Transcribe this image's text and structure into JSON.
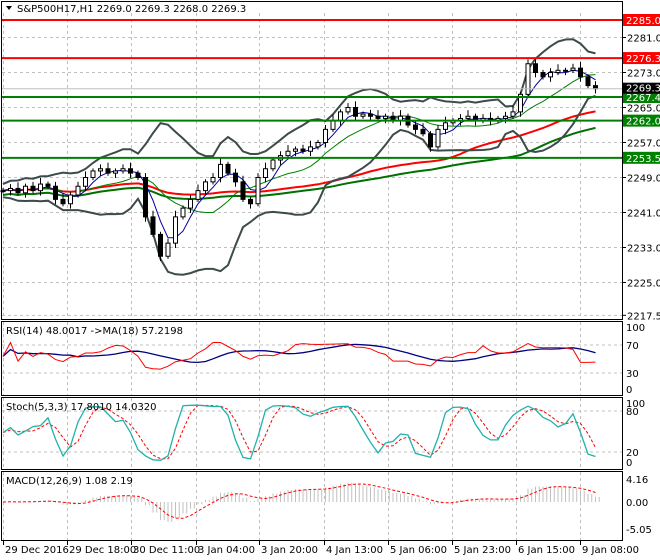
{
  "header": {
    "symbol_line": "S&P500H17,H1  2269.0 2269.3 2268.0 2269.3"
  },
  "colors": {
    "resistance": "#ff0000",
    "support": "#008000",
    "current": "#000000",
    "bands": "#3c4b4b",
    "rsi": "#ff0000",
    "rsi_ma": "#000080",
    "stoch_main": "#20b2aa",
    "stoch_signal": "#ff0000",
    "macd_hist": "#c0c0c0",
    "macd_signal": "#ff0000"
  },
  "chart_data": {
    "type": "candlestick",
    "symbol": "S&P500H17",
    "timeframe": "H1",
    "ohlc_last": {
      "open": 2269.0,
      "high": 2269.3,
      "low": 2268.0,
      "close": 2269.3
    },
    "close": [
      2246,
      2246.5,
      2245.5,
      2247,
      2246,
      2247.5,
      2247,
      2244,
      2243,
      2245,
      2247,
      2249,
      2250.5,
      2251,
      2250,
      2250.5,
      2251,
      2250,
      2249,
      2240,
      2236,
      2231,
      2234,
      2240,
      2242,
      2244,
      2246,
      2248,
      2249,
      2252,
      2250,
      2248,
      2244,
      2243,
      2249,
      2251,
      2253,
      2254,
      2255,
      2255.5,
      2255,
      2256,
      2257,
      2260,
      2262,
      2264,
      2265,
      2263,
      2263.5,
      2263,
      2262.5,
      2263,
      2262,
      2263,
      2261,
      2260,
      2259,
      2256,
      2260,
      2261.5,
      2262,
      2262.5,
      2263,
      2262,
      2262.5,
      2262,
      2262.5,
      2263,
      2264,
      2268,
      2275,
      2273,
      2272,
      2273,
      2273.5,
      2273.5,
      2274,
      2272,
      2270,
      2269.3
    ],
    "ylim": [
      2217.5,
      2289
    ],
    "y_ticks": [
      "2281.0",
      "2273.0",
      "2265.0",
      "2257.0",
      "2249.0",
      "2241.0",
      "2233.0",
      "2225.0",
      "2217.5"
    ],
    "x_ticks": [
      "29 Dec 2016",
      "29 Dec 18:00",
      "30 Dec 11:00",
      "3 Jan 04:00",
      "3 Jan 20:00",
      "4 Jan 13:00",
      "5 Jan 06:00",
      "5 Jan 23:00",
      "6 Jan 15:00",
      "9 Jan 08:00"
    ],
    "levels": [
      {
        "label": "2285.0",
        "value": 2285.0,
        "kind": "resistance"
      },
      {
        "label": "2276.3",
        "value": 2276.3,
        "kind": "resistance"
      },
      {
        "label": "2267.4",
        "value": 2267.4,
        "kind": "support"
      },
      {
        "label": "2262.0",
        "value": 2262.0,
        "kind": "support"
      },
      {
        "label": "2253.5",
        "value": 2253.5,
        "kind": "support"
      }
    ],
    "current_price": {
      "label": "2269.3",
      "value": 2269.3
    },
    "indicators": {
      "rsi": {
        "title": "RSI(14) 48.0017  ->MA(18) 57.2198",
        "rsi": 48.0017,
        "ma": 57.2198,
        "ticks": [
          "100",
          "70",
          "30",
          "0"
        ]
      },
      "stoch": {
        "title": "Stoch(5,3,3) 17.8010 14.0320",
        "k": 17.801,
        "d": 14.032,
        "ticks": [
          "100",
          "80",
          "20",
          "0"
        ]
      },
      "macd": {
        "title": "MACD(12,26,9) 1.08 2.19",
        "macd": 1.08,
        "signal": 2.19,
        "ticks": [
          "4.16",
          "0.00",
          "-5.05"
        ]
      }
    }
  }
}
